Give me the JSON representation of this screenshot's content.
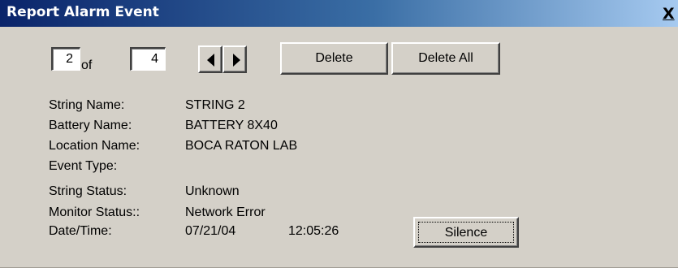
{
  "window": {
    "title": "Report Alarm Event",
    "close_label": "X"
  },
  "navigator": {
    "current": "2",
    "of_label": "of",
    "total": "4"
  },
  "buttons": {
    "delete": "Delete",
    "delete_all": "Delete All",
    "silence": "Silence"
  },
  "details": {
    "string_name_label": "String Name:",
    "string_name": "STRING 2",
    "battery_name_label": "Battery Name:",
    "battery_name": "BATTERY 8X40",
    "location_name_label": "Location Name:",
    "location_name": "BOCA RATON LAB",
    "event_type_label": "Event Type:",
    "event_type": "",
    "string_status_label": "String Status:",
    "string_status": "Unknown",
    "monitor_status_label": "Monitor Status::",
    "monitor_status": "Network Error",
    "datetime_label": "Date/Time:",
    "date": "07/21/04",
    "time": "12:05:26"
  },
  "icons": {
    "prev": "left-arrow-icon",
    "next": "right-arrow-icon",
    "close": "close-icon"
  },
  "colors": {
    "titlebar_start": "#0a246a",
    "titlebar_end": "#a6caf0",
    "window_bg": "#d4d0c8"
  }
}
